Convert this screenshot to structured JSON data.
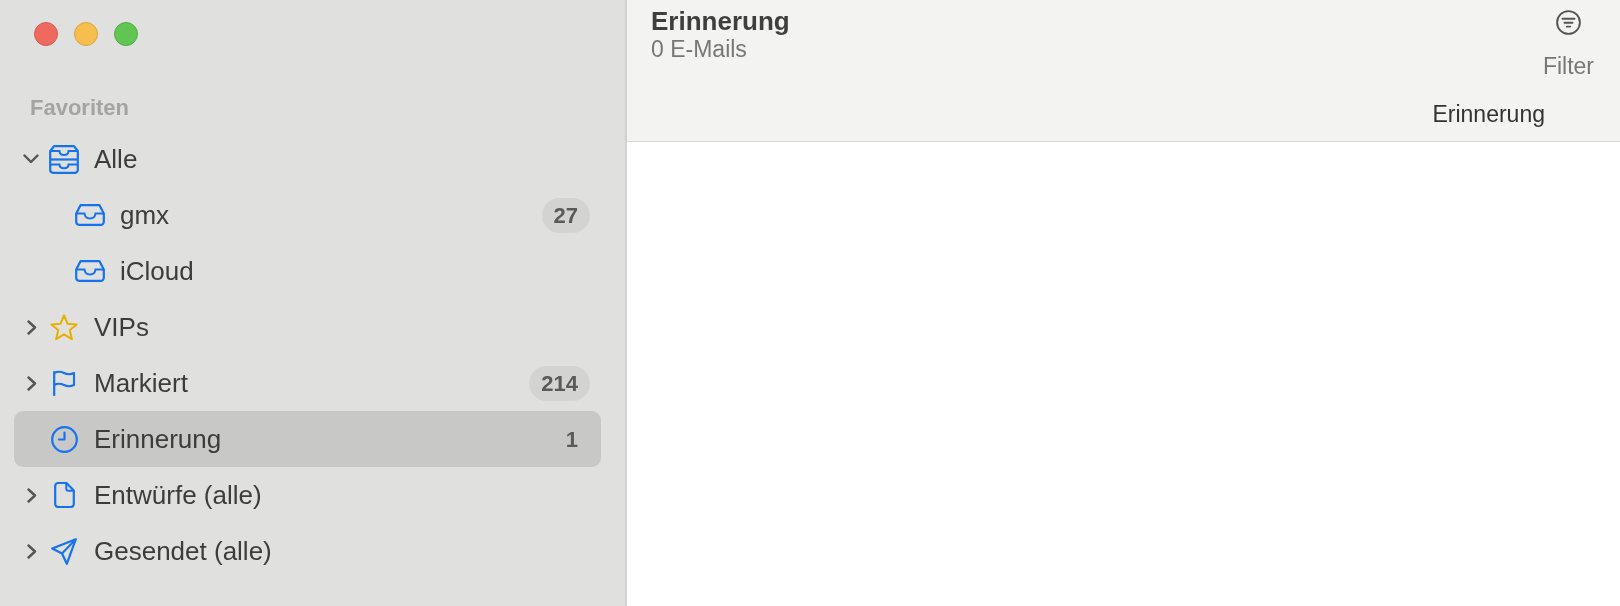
{
  "sidebar": {
    "section_title": "Favoriten",
    "items": [
      {
        "label": "Alle",
        "kind": "all",
        "expanded": true,
        "selected": false,
        "children": [
          {
            "label": "gmx",
            "kind": "mailbox",
            "selected": false,
            "count": "27"
          },
          {
            "label": "iCloud",
            "kind": "mailbox",
            "selected": false
          }
        ]
      },
      {
        "label": "VIPs",
        "kind": "vip",
        "expanded": false,
        "selected": false
      },
      {
        "label": "Markiert",
        "kind": "flagged",
        "expanded": false,
        "selected": false,
        "count": "214"
      },
      {
        "label": "Erinnerung",
        "kind": "reminder",
        "selected": true,
        "count": "1"
      },
      {
        "label": "Entwürfe (alle)",
        "kind": "drafts",
        "expanded": false,
        "selected": false
      },
      {
        "label": "Gesendet (alle)",
        "kind": "sent",
        "expanded": false,
        "selected": false
      }
    ]
  },
  "mailbox_header": {
    "title": "Erinnerung",
    "subtitle": "0 E-Mails",
    "filter_button": {
      "label": "Filter"
    },
    "sort_column": "Erinnerung"
  }
}
